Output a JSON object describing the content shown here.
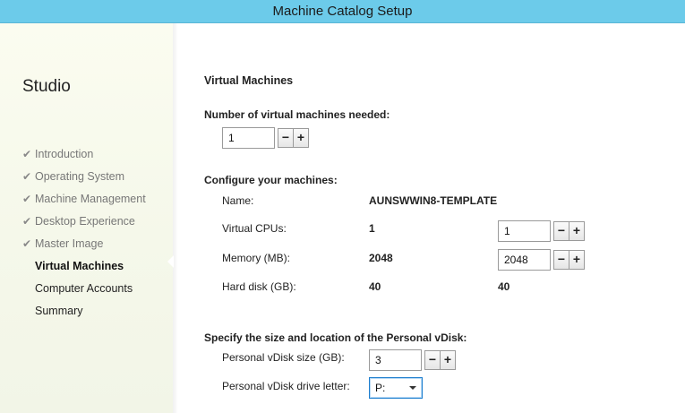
{
  "window": {
    "title": "Machine Catalog Setup"
  },
  "sidebar": {
    "heading": "Studio",
    "steps": [
      {
        "label": "Introduction",
        "status": "done"
      },
      {
        "label": "Operating System",
        "status": "done"
      },
      {
        "label": "Machine Management",
        "status": "done"
      },
      {
        "label": "Desktop Experience",
        "status": "done"
      },
      {
        "label": "Master Image",
        "status": "done"
      },
      {
        "label": "Virtual Machines",
        "status": "current"
      },
      {
        "label": "Computer Accounts",
        "status": "pending"
      },
      {
        "label": "Summary",
        "status": "pending"
      }
    ],
    "check_glyph": "✔"
  },
  "main": {
    "title": "Virtual Machines",
    "vm_count": {
      "label": "Number of virtual machines needed:",
      "value": "1",
      "minus": "−",
      "plus": "+"
    },
    "configure": {
      "heading": "Configure your machines:",
      "name_label": "Name:",
      "name_value": "AUNSWWIN8-TEMPLATE",
      "cpus_label": "Virtual CPUs:",
      "cpus_value": "1",
      "cpus_input": "1",
      "memory_label": "Memory (MB):",
      "memory_value": "2048",
      "memory_input": "2048",
      "disk_label": "Hard disk (GB):",
      "disk_value": "40",
      "disk_value2": "40"
    },
    "pvd": {
      "heading": "Specify the size and location of the Personal vDisk:",
      "size_label": "Personal vDisk size (GB):",
      "size_input": "3",
      "drive_label": "Personal vDisk drive letter:",
      "drive_value": "P:"
    },
    "spin_minus": "−",
    "spin_plus": "+"
  }
}
